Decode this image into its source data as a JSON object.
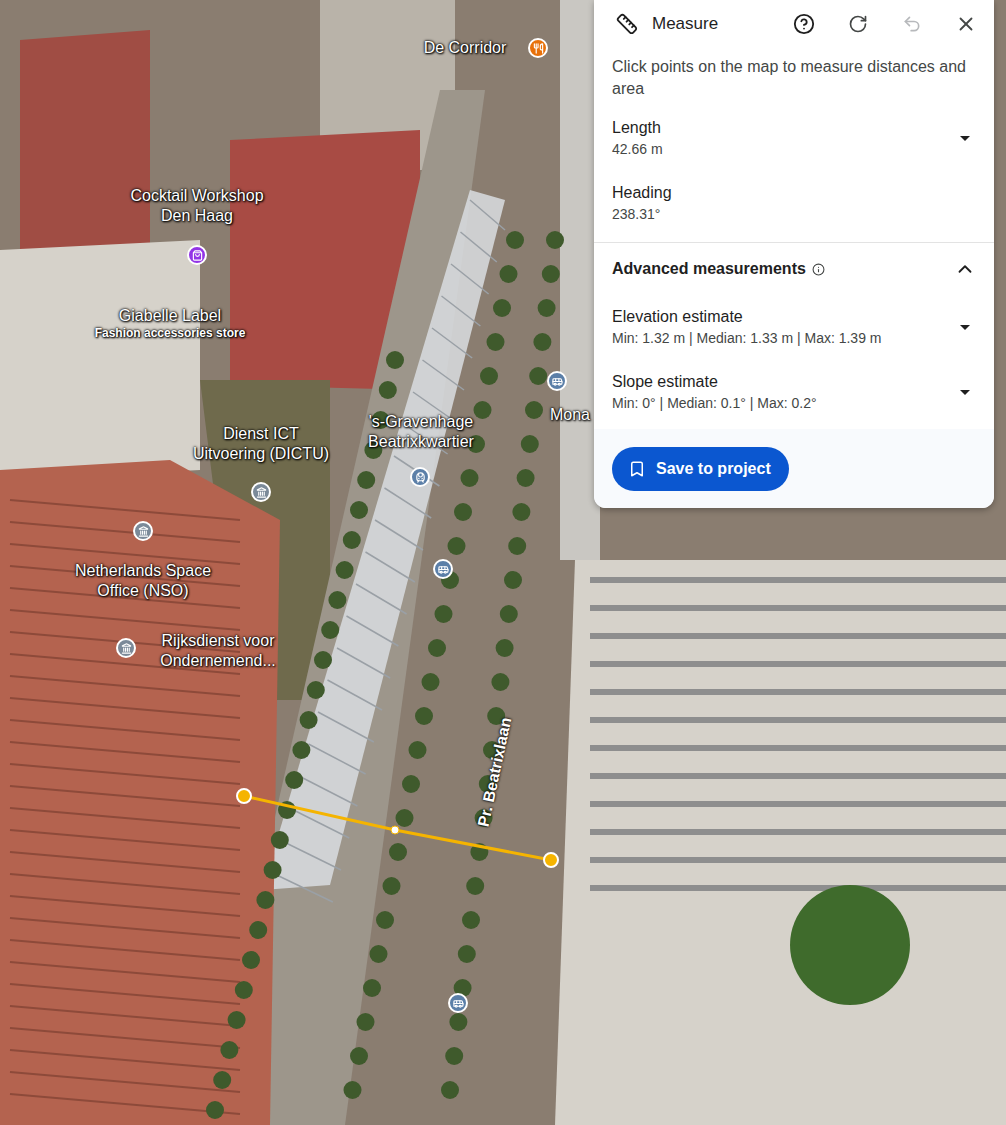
{
  "map": {
    "labels": [
      {
        "lines": [
          "De Corridor"
        ]
      },
      {
        "lines": [
          "Cocktail Workshop",
          "Den Haag"
        ]
      },
      {
        "lines": [
          "Giabelle Label"
        ],
        "subtitle": "Fashion accessories store"
      },
      {
        "lines": [
          "Dienst ICT",
          "Uitvoering (DICTU)"
        ]
      },
      {
        "lines": [
          "'s-Gravenhage",
          "Beatrixkwartier"
        ]
      },
      {
        "lines": [
          "Mona"
        ]
      },
      {
        "lines": [
          "Netherlands Space",
          "Office (NSO)"
        ]
      },
      {
        "lines": [
          "Rijksdienst voor",
          "Ondernemend..."
        ]
      }
    ],
    "road_label": "Pr. Beatrixlaan",
    "pins": [
      {
        "kind": "restaurant",
        "color": "#e8710a"
      },
      {
        "kind": "shop",
        "color": "#9334e6"
      },
      {
        "kind": "government",
        "color": "#7b8a99"
      },
      {
        "kind": "government",
        "color": "#7b8a99"
      },
      {
        "kind": "government",
        "color": "#7b8a99"
      },
      {
        "kind": "train",
        "color": "#5b7fa8"
      },
      {
        "kind": "bus",
        "color": "#5b7fa8"
      },
      {
        "kind": "bus",
        "color": "#5b7fa8"
      },
      {
        "kind": "bus",
        "color": "#5b7fa8"
      }
    ]
  },
  "panel": {
    "title": "Measure",
    "undo_disabled": true,
    "instructions": "Click points on the map to measure distances and area",
    "rows": [
      {
        "label": "Length",
        "value": "42.66 m",
        "kind": "dropdown",
        "expanded": false
      },
      {
        "label": "Heading",
        "value": "238.31°",
        "kind": "static",
        "expanded": false
      }
    ],
    "advanced": {
      "label": "Advanced measurements",
      "expanded": true,
      "rows": [
        {
          "label": "Elevation estimate",
          "value": "Min: 1.32 m | Median: 1.33 m | Max: 1.39 m",
          "kind": "dropdown",
          "expanded": false
        },
        {
          "label": "Slope estimate",
          "value": "Min: 0° | Median: 0.1° | Max: 0.2°",
          "kind": "dropdown",
          "expanded": false
        }
      ]
    },
    "button": "Save to project"
  }
}
